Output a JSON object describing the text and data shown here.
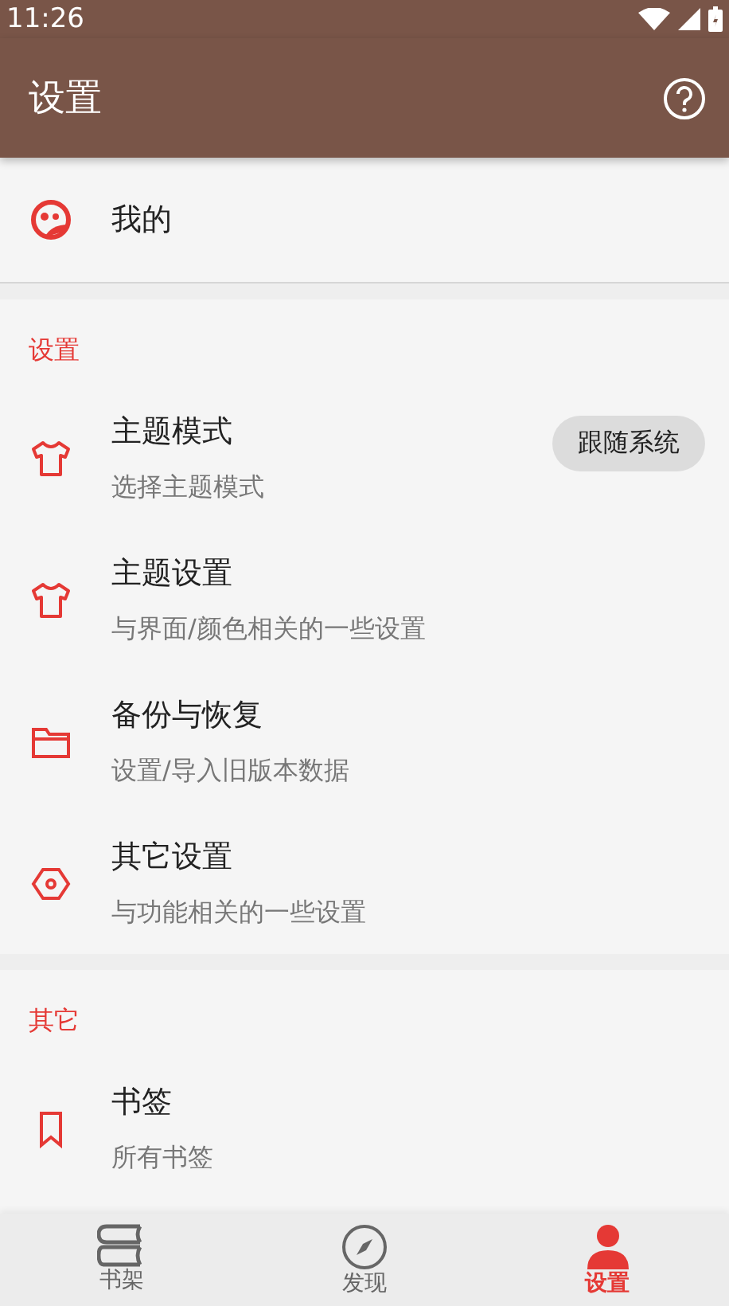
{
  "status_bar": {
    "time": "11:26"
  },
  "app_bar": {
    "title": "设置"
  },
  "profile": {
    "label": "我的"
  },
  "sections": [
    {
      "title": "设置",
      "items": [
        {
          "title": "主题模式",
          "subtitle": "选择主题模式",
          "value": "跟随系统"
        },
        {
          "title": "主题设置",
          "subtitle": "与界面/颜色相关的一些设置"
        },
        {
          "title": "备份与恢复",
          "subtitle": "设置/导入旧版本数据"
        },
        {
          "title": "其它设置",
          "subtitle": "与功能相关的一些设置"
        }
      ]
    },
    {
      "title": "其它",
      "items": [
        {
          "title": "书签",
          "subtitle": "所有书签"
        }
      ]
    }
  ],
  "bottom_nav": [
    {
      "label": "书架",
      "selected": false
    },
    {
      "label": "发现",
      "selected": false
    },
    {
      "label": "设置",
      "selected": true
    }
  ]
}
